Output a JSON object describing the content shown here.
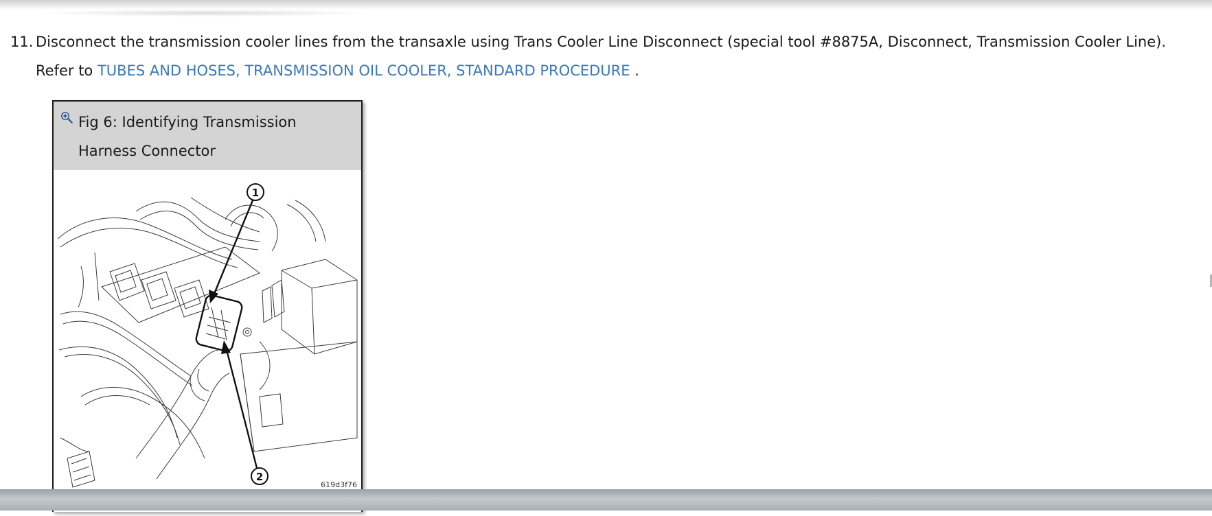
{
  "step": {
    "number": "11.",
    "text_before": "Disconnect the transmission cooler lines from the transaxle using Trans Cooler Line Disconnect (special tool #8875A, Disconnect, Transmission Cooler Line). Refer to ",
    "link_text": "TUBES AND HOSES, TRANSMISSION OIL COOLER, STANDARD PROCEDURE",
    "text_after": " ."
  },
  "figure": {
    "zoom_icon": "magnifier-plus-icon",
    "caption": "Fig 6: Identifying Transmission Harness Connector",
    "callouts": [
      "1",
      "2"
    ],
    "image_code": "619d3f76"
  },
  "colors": {
    "link": "#3a78b8",
    "header_bg": "#d4d4d4",
    "text": "#1a1a1a"
  }
}
